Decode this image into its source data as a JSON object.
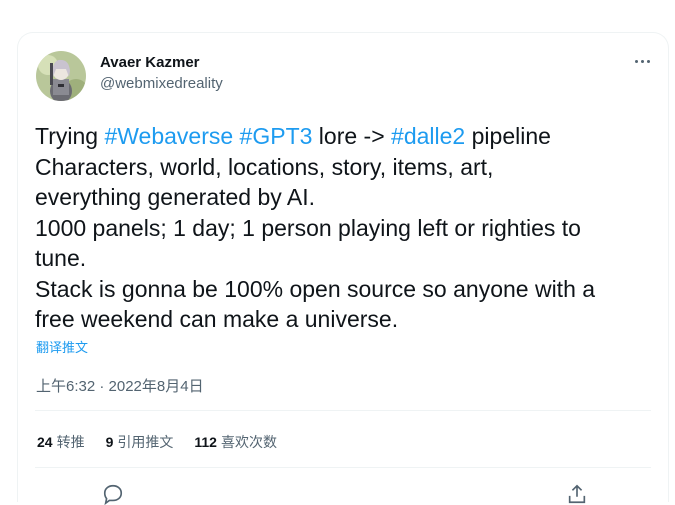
{
  "tweet": {
    "author": {
      "display_name": "Avaer Kazmer",
      "handle": "@webmixedreality"
    },
    "text_lines": [
      [
        {
          "text": "Trying ",
          "type": "text"
        },
        {
          "text": "#Webaverse",
          "type": "hashtag"
        },
        {
          "text": " ",
          "type": "text"
        },
        {
          "text": "#GPT3",
          "type": "hashtag"
        },
        {
          "text": " lore -> ",
          "type": "text"
        },
        {
          "text": "#dalle2",
          "type": "hashtag"
        },
        {
          "text": " pipeline",
          "type": "text"
        }
      ],
      [
        {
          "text": "Characters, world, locations, story, items, art,",
          "type": "text"
        }
      ],
      [
        {
          "text": "everything generated by AI.",
          "type": "text"
        }
      ],
      [
        {
          "text": "1000 panels; 1 day; 1 person playing left or righties to",
          "type": "text"
        }
      ],
      [
        {
          "text": "tune.",
          "type": "text"
        }
      ],
      [
        {
          "text": "Stack is gonna be 100% open source so anyone with a",
          "type": "text"
        }
      ],
      [
        {
          "text": "free weekend can make a universe.",
          "type": "text"
        }
      ]
    ],
    "translate_label": "翻译推文",
    "timestamp": "上午6:32 · 2022年8月4日",
    "stats": {
      "retweets_count": "24",
      "retweets_label": "转推",
      "quotes_count": "9",
      "quotes_label": "引用推文",
      "likes_count": "112",
      "likes_label": "喜欢次数"
    }
  },
  "colors": {
    "link": "#1d9bf0",
    "text_primary": "#0f1419",
    "text_secondary": "#536471",
    "divider": "#eff3f4"
  },
  "icons": {
    "more": "more-horizontal-icon",
    "reply": "reply-icon",
    "share": "share-icon"
  }
}
